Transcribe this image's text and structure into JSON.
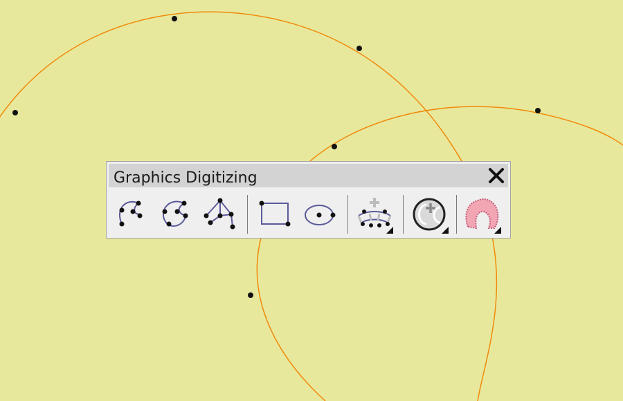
{
  "background": {
    "color": "#e8e89c",
    "curve_color": "#ef8a0b",
    "point_color": "#111111"
  },
  "toolbar": {
    "title": "Graphics Digitizing",
    "tools": [
      {
        "name": "digitize-arc-curve-tool",
        "icon": "arc-points-icon"
      },
      {
        "name": "digitize-closed-curve-tool",
        "icon": "closed-curve-points-icon"
      },
      {
        "name": "digitize-polyline-tool",
        "icon": "polyline-points-icon"
      },
      {
        "name": "digitize-rectangle-tool",
        "icon": "rectangle-icon"
      },
      {
        "name": "digitize-ellipse-tool",
        "icon": "ellipse-icon"
      },
      {
        "name": "add-arc-point-tool",
        "icon": "plus-arc-icon",
        "dropdown": true
      },
      {
        "name": "circle-tool",
        "icon": "circle-c-icon",
        "dropdown": true
      },
      {
        "name": "freeform-fill-tool",
        "icon": "pink-shape-icon",
        "dropdown": true
      }
    ]
  }
}
